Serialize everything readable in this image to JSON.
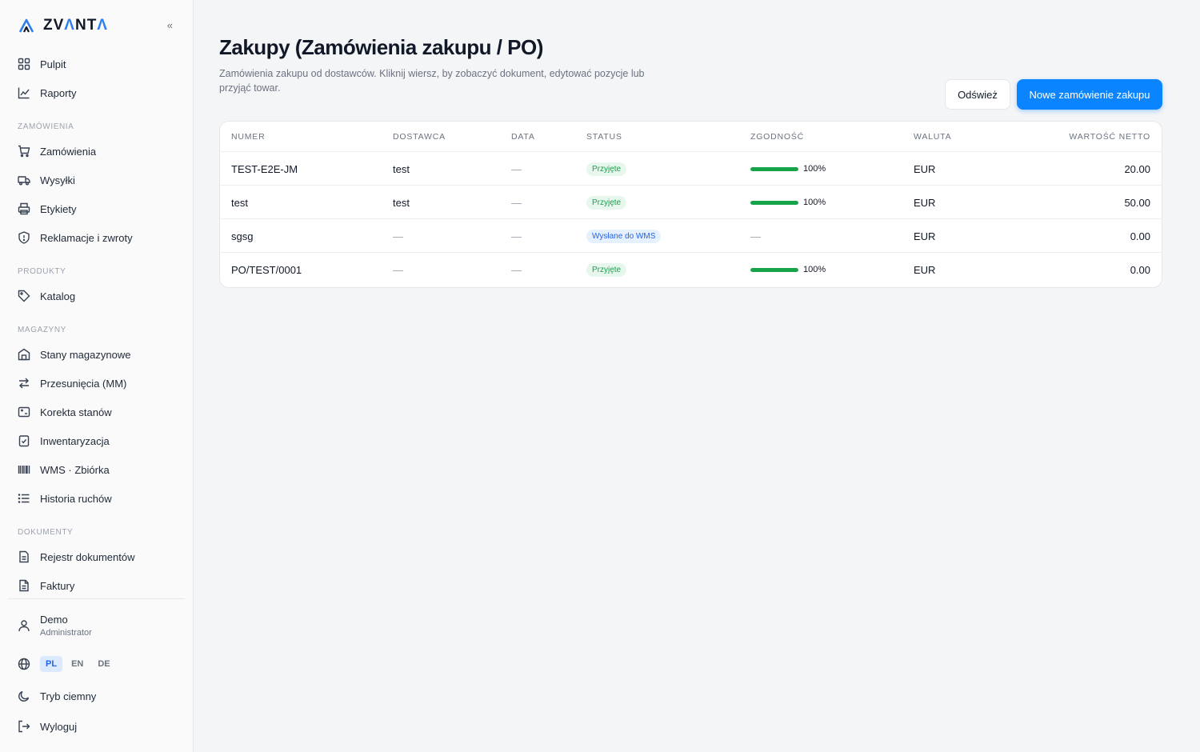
{
  "brand": {
    "name_a": "ZV",
    "name_b": "Λ",
    "name_c": "NT",
    "name_d": "Λ",
    "collapse": "«"
  },
  "nav": {
    "top": [
      {
        "label": "Pulpit",
        "icon": "grid-icon"
      },
      {
        "label": "Raporty",
        "icon": "chart-icon"
      }
    ],
    "sections": [
      {
        "title": "ZAMÓWIENIA",
        "items": [
          {
            "label": "Zamówienia",
            "icon": "cart-icon"
          },
          {
            "label": "Wysyłki",
            "icon": "truck-icon"
          },
          {
            "label": "Etykiety",
            "icon": "printer-icon"
          },
          {
            "label": "Reklamacje i zwroty",
            "icon": "shield-icon"
          }
        ]
      },
      {
        "title": "PRODUKTY",
        "items": [
          {
            "label": "Katalog",
            "icon": "tag-icon"
          }
        ]
      },
      {
        "title": "MAGAZYNY",
        "items": [
          {
            "label": "Stany magazynowe",
            "icon": "warehouse-icon"
          },
          {
            "label": "Przesunięcia (MM)",
            "icon": "arrows-icon"
          },
          {
            "label": "Korekta stanów",
            "icon": "adjust-icon"
          },
          {
            "label": "Inwentaryzacja",
            "icon": "clipboard-check-icon"
          },
          {
            "label": "WMS · Zbiórka",
            "icon": "barcode-icon"
          },
          {
            "label": "Historia ruchów",
            "icon": "list-icon"
          }
        ]
      },
      {
        "title": "DOKUMENTY",
        "items": [
          {
            "label": "Rejestr dokumentów",
            "icon": "document-icon"
          },
          {
            "label": "Faktury",
            "icon": "invoice-icon"
          }
        ]
      }
    ]
  },
  "user": {
    "name": "Demo",
    "role": "Administrator"
  },
  "languages": [
    {
      "code": "PL",
      "active": true
    },
    {
      "code": "EN",
      "active": false
    },
    {
      "code": "DE",
      "active": false
    }
  ],
  "footer": {
    "dark_mode": "Tryb ciemny",
    "logout": "Wyloguj"
  },
  "page": {
    "title": "Zakupy (Zamówienia zakupu / PO)",
    "subtitle": "Zamówienia zakupu od dostawców. Kliknij wiersz, by zobaczyć dokument, edytować pozycje lub przyjąć towar.",
    "refresh_label": "Odśwież",
    "new_label": "Nowe zamówienie zakupu"
  },
  "table": {
    "headers": [
      "NUMER",
      "DOSTAWCA",
      "DATA",
      "STATUS",
      "ZGODNOŚĆ",
      "WALUTA",
      "WARTOŚĆ NETTO"
    ],
    "rows": [
      {
        "numer": "TEST-E2E-JM",
        "dostawca": "test",
        "data": "—",
        "status": "Przyjęte",
        "status_kind": "green",
        "zgodnosc": "100%",
        "zgodnosc_value": 100,
        "waluta": "EUR",
        "netto": "20.00"
      },
      {
        "numer": "test",
        "dostawca": "test",
        "data": "—",
        "status": "Przyjęte",
        "status_kind": "green",
        "zgodnosc": "100%",
        "zgodnosc_value": 100,
        "waluta": "EUR",
        "netto": "50.00"
      },
      {
        "numer": "sgsg",
        "dostawca": "—",
        "data": "—",
        "status": "Wysłane do WMS",
        "status_kind": "blue",
        "zgodnosc": "—",
        "zgodnosc_value": null,
        "waluta": "EUR",
        "netto": "0.00"
      },
      {
        "numer": "PO/TEST/0001",
        "dostawca": "—",
        "data": "—",
        "status": "Przyjęte",
        "status_kind": "green",
        "zgodnosc": "100%",
        "zgodnosc_value": 100,
        "waluta": "EUR",
        "netto": "0.00"
      }
    ]
  },
  "colors": {
    "accent": "#0a84ff",
    "success": "#16a34a",
    "info": "#2563eb"
  }
}
